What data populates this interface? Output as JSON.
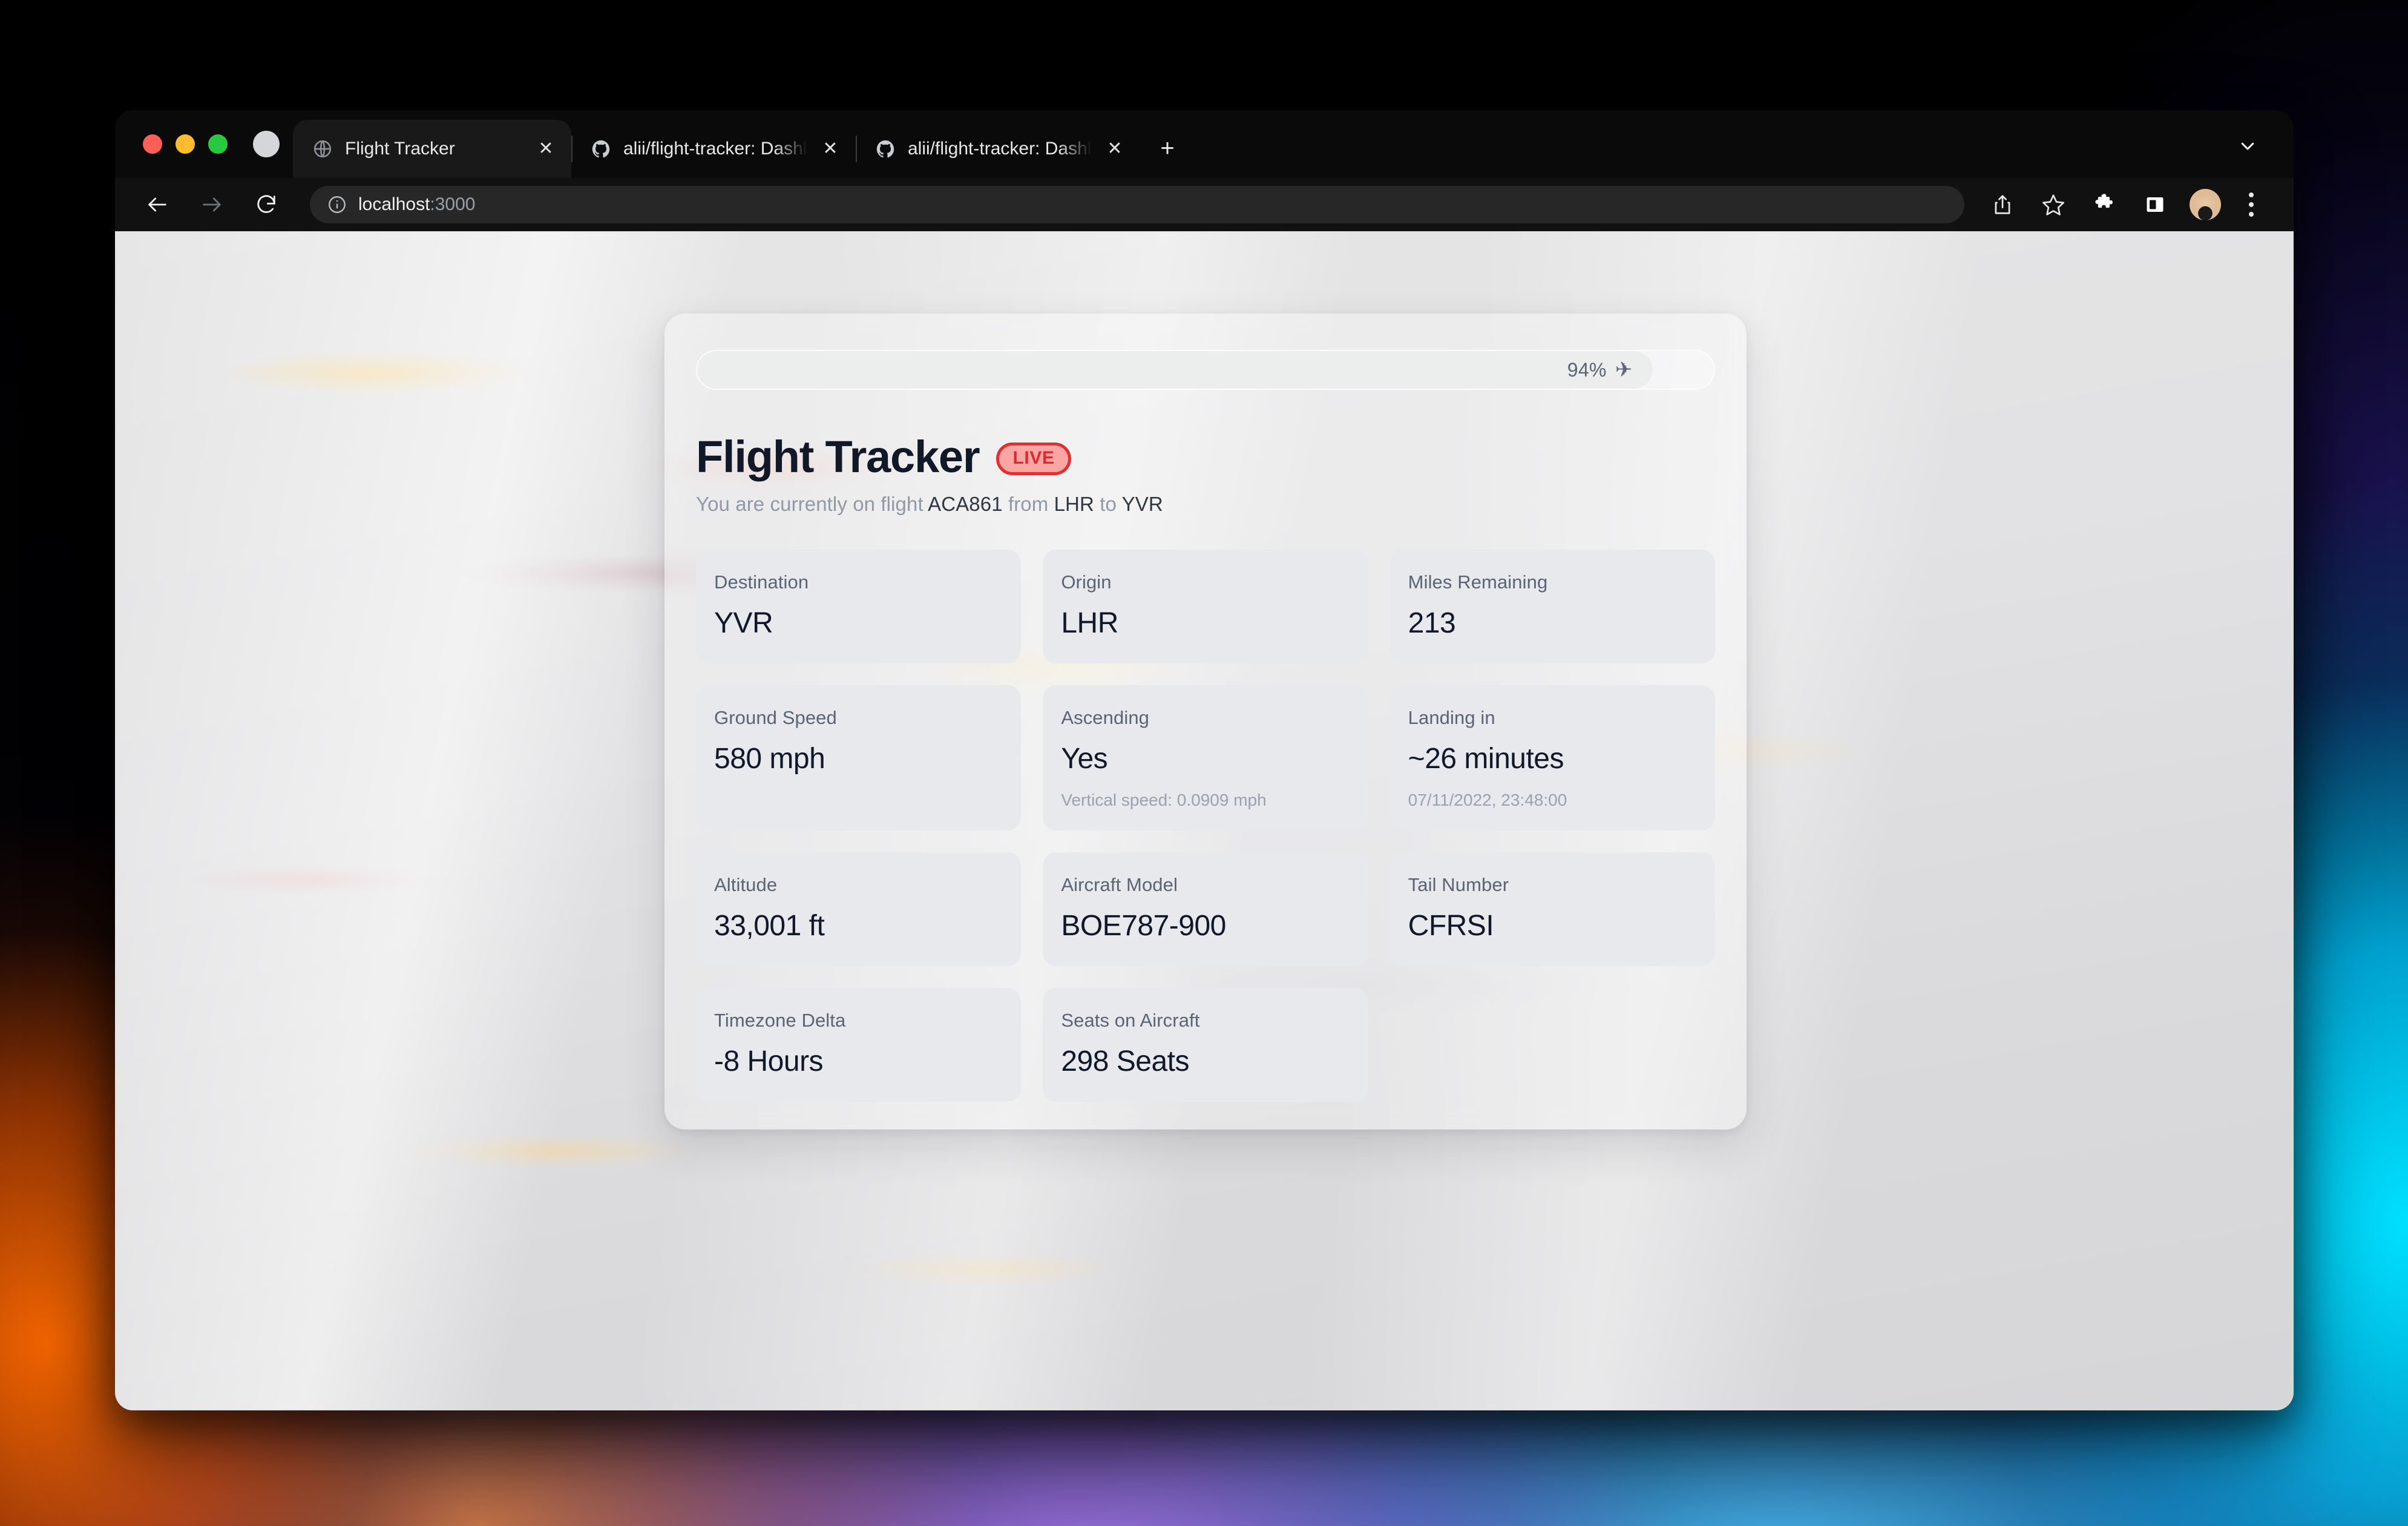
{
  "browser": {
    "traffic_lights": [
      "close",
      "minimize",
      "zoom"
    ],
    "tabs": [
      {
        "title": "Flight Tracker",
        "favicon": "globe-icon",
        "active": true,
        "close": "✕"
      },
      {
        "title": "alii/flight-tracker: Dashboard fo",
        "favicon": "github-icon",
        "active": false,
        "close": "✕"
      },
      {
        "title": "alii/flight-tracker: Dashboard fo",
        "favicon": "github-icon",
        "active": false,
        "close": "✕"
      }
    ],
    "new_tab_label": "+",
    "toolbar": {
      "back_icon": "back-arrow-icon",
      "forward_icon": "forward-arrow-icon",
      "reload_icon": "reload-icon",
      "info_icon": "site-info-icon",
      "url_host": "localhost",
      "url_port": ":3000",
      "share_icon": "share-icon",
      "bookmark_icon": "star-icon",
      "extensions_icon": "puzzle-icon",
      "sidepanel_icon": "side-panel-icon",
      "profile_icon": "avatar",
      "menu_icon": "kebab-menu-icon"
    }
  },
  "app": {
    "progress": {
      "percent_label": "94%",
      "percent_value": 94,
      "plane_glyph": "✈"
    },
    "title": "Flight Tracker",
    "live_badge": "LIVE",
    "subtitle": {
      "prefix": "You are currently on flight ",
      "flight_number": "ACA861",
      "mid": " from ",
      "origin": "LHR",
      "joiner": " to ",
      "destination": "YVR"
    },
    "cards": [
      {
        "label": "Destination",
        "value": "YVR"
      },
      {
        "label": "Origin",
        "value": "LHR"
      },
      {
        "label": "Miles Remaining",
        "value": "213"
      },
      {
        "label": "Ground Speed",
        "value": "580 mph"
      },
      {
        "label": "Ascending",
        "value": "Yes",
        "sub": "Vertical speed: 0.0909 mph"
      },
      {
        "label": "Landing in",
        "value": "~26 minutes",
        "sub": "07/11/2022, 23:48:00"
      },
      {
        "label": "Altitude",
        "value": "33,001 ft"
      },
      {
        "label": "Aircraft Model",
        "value": "BOE787-900"
      },
      {
        "label": "Tail Number",
        "value": "CFRSI"
      },
      {
        "label": "Timezone Delta",
        "value": "-8 Hours"
      },
      {
        "label": "Seats on Aircraft",
        "value": "298 Seats"
      }
    ]
  },
  "colors": {
    "accent_red": "#e03131",
    "badge_fill": "#fca5a5",
    "title_dark": "#111827",
    "card_bg": "#e7e9ed",
    "muted": "#5a6472"
  }
}
